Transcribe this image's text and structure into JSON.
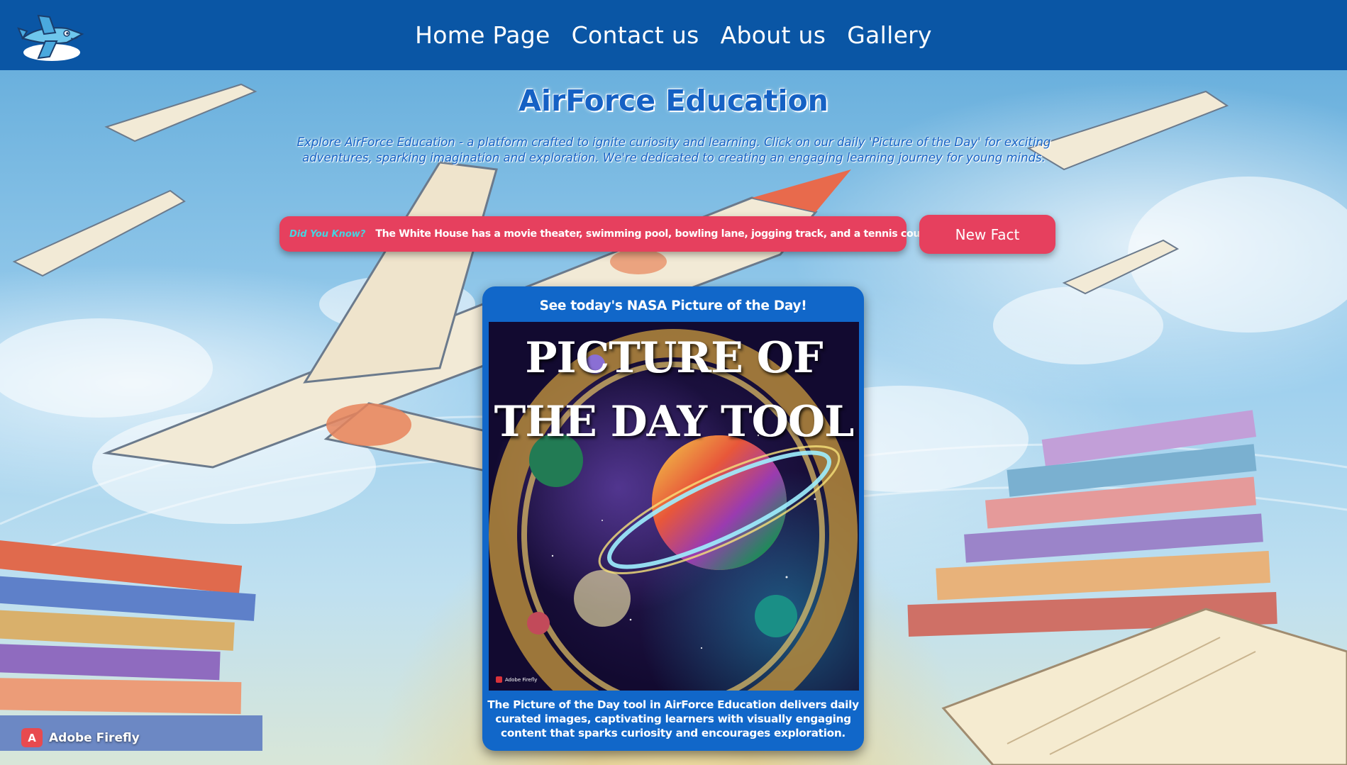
{
  "header": {
    "nav": [
      {
        "label": "Home Page"
      },
      {
        "label": "Contact us"
      },
      {
        "label": "About us"
      },
      {
        "label": "Gallery"
      }
    ],
    "logo_icon": "cartoon-jet-icon",
    "bar_color": "#0a56a5"
  },
  "hero": {
    "title": "AirForce Education",
    "intro": "Explore AirForce Education - a platform crafted to ignite curiosity and learning. Click on our daily 'Picture of the Day' for exciting adventures, sparking imagination and exploration. We're dedicated to creating an engaging learning journey for young minds."
  },
  "fact": {
    "label": "Did You Know?",
    "text": "The White House has a movie theater, swimming pool, bowling lane, jogging track, and a tennis court",
    "button_label": "New Fact",
    "accent_color": "#e6405e"
  },
  "card": {
    "title": "See today's NASA Picture of the Day!",
    "poster_title": "PICTURE OF THE DAY TOOL",
    "poster_watermark": "Adobe Firefly",
    "description": "The Picture of the Day tool in AirForce Education delivers daily curated images, captivating learners with visually engaging content that sparks curiosity and encourages exploration.",
    "color": "#1167c9"
  },
  "watermark": {
    "label": "Adobe Firefly"
  }
}
